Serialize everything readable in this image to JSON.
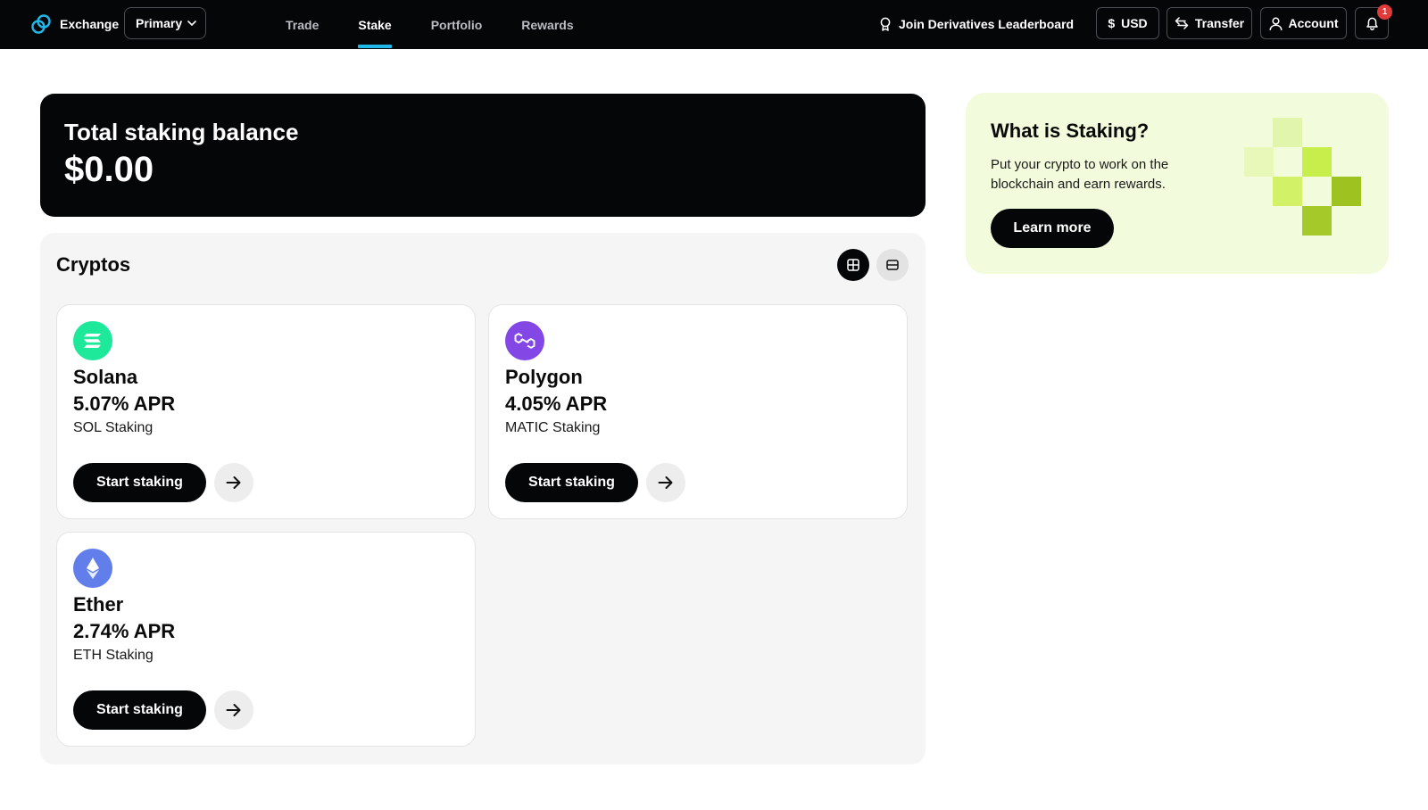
{
  "header": {
    "brand_name": "Exchange",
    "account_selector": "Primary",
    "nav": [
      {
        "label": "Trade",
        "active": false
      },
      {
        "label": "Stake",
        "active": true
      },
      {
        "label": "Portfolio",
        "active": false
      },
      {
        "label": "Rewards",
        "active": false
      }
    ],
    "leaderboard_link": "Join Derivatives Leaderboard",
    "currency_label": "USD",
    "currency_symbol": "$",
    "transfer_label": "Transfer",
    "account_label": "Account",
    "notification_count": "1",
    "accent_color": "#1fb8e8"
  },
  "balance": {
    "label": "Total staking balance",
    "amount": "$0.00"
  },
  "cryptos": {
    "title": "Cryptos",
    "view_mode": "grid",
    "items": [
      {
        "name": "Solana",
        "apr": "5.07% APR",
        "subtitle": "SOL Staking",
        "button": "Start staking",
        "icon": "solana-icon",
        "color": "#1ee89a"
      },
      {
        "name": "Polygon",
        "apr": "4.05% APR",
        "subtitle": "MATIC Staking",
        "button": "Start staking",
        "icon": "polygon-icon",
        "color": "#8247e5"
      },
      {
        "name": "Ether",
        "apr": "2.74% APR",
        "subtitle": "ETH Staking",
        "button": "Start staking",
        "icon": "ethereum-icon",
        "color": "#627eea"
      }
    ]
  },
  "promo": {
    "title": "What is Staking?",
    "description": "Put your crypto to work on the blockchain and earn rewards.",
    "button": "Learn more",
    "background": "#f2fbdc"
  }
}
